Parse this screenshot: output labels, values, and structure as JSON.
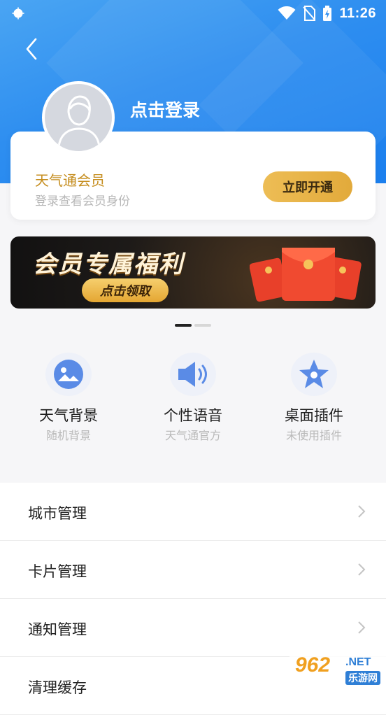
{
  "status_bar": {
    "time": "11:26",
    "left_icon": "android-notification-icon",
    "icons": [
      "wifi-icon",
      "no-sim-icon",
      "battery-icon"
    ]
  },
  "header": {
    "back_icon": "back-arrow-icon",
    "login_text": "点击登录"
  },
  "membership": {
    "title": "天气通会员",
    "subtitle": "登录查看会员身份",
    "button_label": "立即开通"
  },
  "banner": {
    "title": "会员专属福利",
    "button_label": "点击领取",
    "page_count": 2,
    "active_page": 1
  },
  "features": [
    {
      "title": "天气背景",
      "subtitle": "随机背景",
      "icon": "image-icon"
    },
    {
      "title": "个性语音",
      "subtitle": "天气通官方",
      "icon": "speaker-icon"
    },
    {
      "title": "桌面插件",
      "subtitle": "未使用插件",
      "icon": "star-icon"
    }
  ],
  "menu": [
    {
      "label": "城市管理"
    },
    {
      "label": "卡片管理"
    },
    {
      "label": "通知管理"
    },
    {
      "label": "清理缓存"
    }
  ],
  "watermark": {
    "number": "962",
    "suffix": ".NET",
    "site": "乐游网"
  },
  "colors": {
    "header_blue": "#2e8ef0",
    "gold": "#e4ae45",
    "member_text": "#c58d1e",
    "feature_icon": "#5a8be6"
  }
}
